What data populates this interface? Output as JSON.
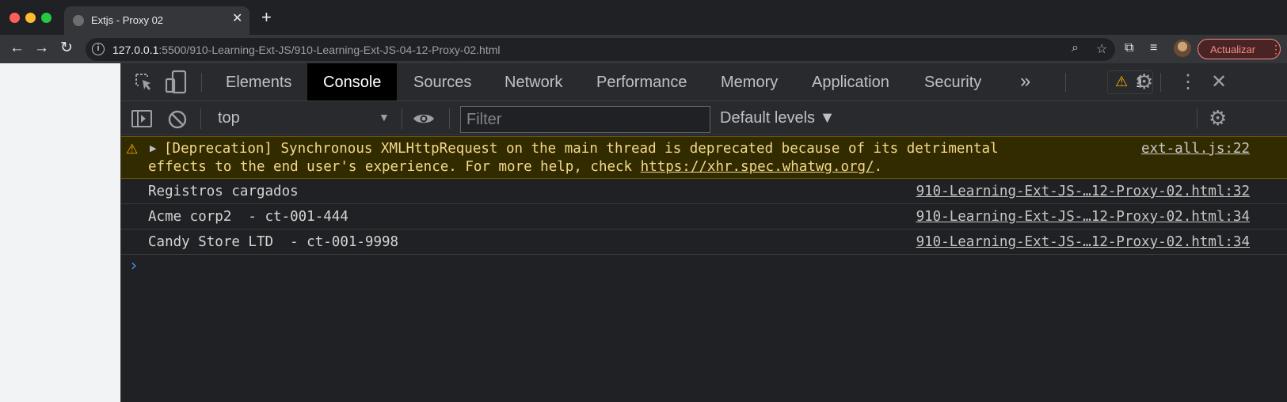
{
  "browser": {
    "tab_title": "Extjs - Proxy 02",
    "tab_close": "✕",
    "new_tab": "+",
    "url_host": "127.0.0.1",
    "url_path": ":5500/910-Learning-Ext-JS/910-Learning-Ext-JS-04-12-Proxy-02.html",
    "update_label": "Actualizar"
  },
  "devtools": {
    "tabs": [
      {
        "label": "Elements"
      },
      {
        "label": "Console"
      },
      {
        "label": "Sources"
      },
      {
        "label": "Network"
      },
      {
        "label": "Performance"
      },
      {
        "label": "Memory"
      },
      {
        "label": "Application"
      },
      {
        "label": "Security"
      }
    ],
    "more_tabs": "»",
    "warning_count": "1",
    "context": "top",
    "filter_placeholder": "Filter",
    "levels": "Default levels ▼"
  },
  "console": {
    "warning": {
      "line1": "[Deprecation] Synchronous XMLHttpRequest on the main thread is deprecated because of its detrimental",
      "line2_prefix": "effects to the end user's experience. For more help, check ",
      "link": "https://xhr.spec.whatwg.org/",
      "line2_suffix": ".",
      "source": "ext-all.js:22"
    },
    "messages": [
      {
        "text": "Registros cargados",
        "source": "910-Learning-Ext-JS-…12-Proxy-02.html:32"
      },
      {
        "text": "Acme corp2  - ct-001-444",
        "source": "910-Learning-Ext-JS-…12-Proxy-02.html:34"
      },
      {
        "text": "Candy Store LTD  - ct-001-9998",
        "source": "910-Learning-Ext-JS-…12-Proxy-02.html:34"
      }
    ]
  }
}
